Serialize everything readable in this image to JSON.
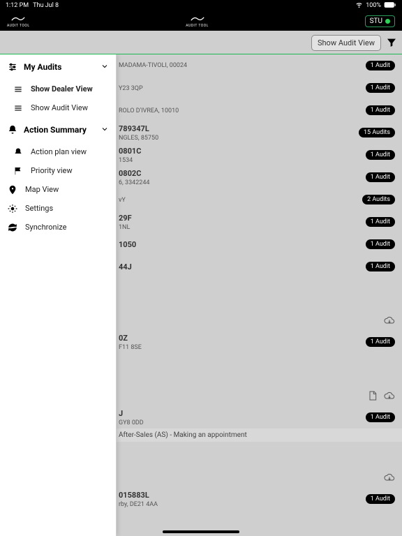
{
  "status": {
    "time": "1:12 PM",
    "date": "Thu Jul 8",
    "battery": "100%"
  },
  "header": {
    "logo_sub": "AUDIT TOOL",
    "chip": "STU"
  },
  "toolbar": {
    "show_view": "Show Audit View"
  },
  "sidebar": {
    "s1": {
      "title": "My Audits",
      "i1": "Show Dealer View",
      "i2": "Show Audit View"
    },
    "s2": {
      "title": "Action Summary",
      "i1": "Action plan view",
      "i2": "Priority view"
    },
    "map": "Map View",
    "settings": "Settings",
    "sync": "Synchronize"
  },
  "rows": {
    "r0": {
      "sub": "MADAMA-TIVOLI, 00024",
      "badge": "1 Audit"
    },
    "r1": {
      "title": "",
      "sub": "Y23 3QP",
      "badge": "1 Audit"
    },
    "r2": {
      "title": "",
      "sub": "ROLO D'IVREA, 10010",
      "badge": "1 Audit"
    },
    "r3": {
      "title": "789347L",
      "sub": "NGLES, 85750",
      "badge": "15 Audits"
    },
    "r4": {
      "title": "0801C",
      "sub": "1534",
      "badge": "1 Audit"
    },
    "r5": {
      "title": "0802C",
      "sub": "6, 3342244",
      "badge": "1 Audit"
    },
    "r6": {
      "title": "",
      "sub": "vY",
      "badge": "2 Audits"
    },
    "r7": {
      "title": "29F",
      "sub": "1NL",
      "badge": "1 Audit"
    },
    "r8": {
      "title": "1050",
      "sub": "",
      "badge": "1 Audit"
    },
    "r9": {
      "title": "44J",
      "sub": "",
      "badge": "1 Audit"
    },
    "r10": {
      "title": "0Z",
      "sub": "F11 8SE",
      "badge": "1 Audit"
    },
    "r11": {
      "title": "J",
      "sub": "GY8 0DD",
      "badge": "1 Audit"
    },
    "note": "After-Sales (AS) - Making an appointment",
    "r12": {
      "title": "015883L",
      "sub": "rby, DE21 4AA",
      "badge": "1 Audit"
    }
  }
}
